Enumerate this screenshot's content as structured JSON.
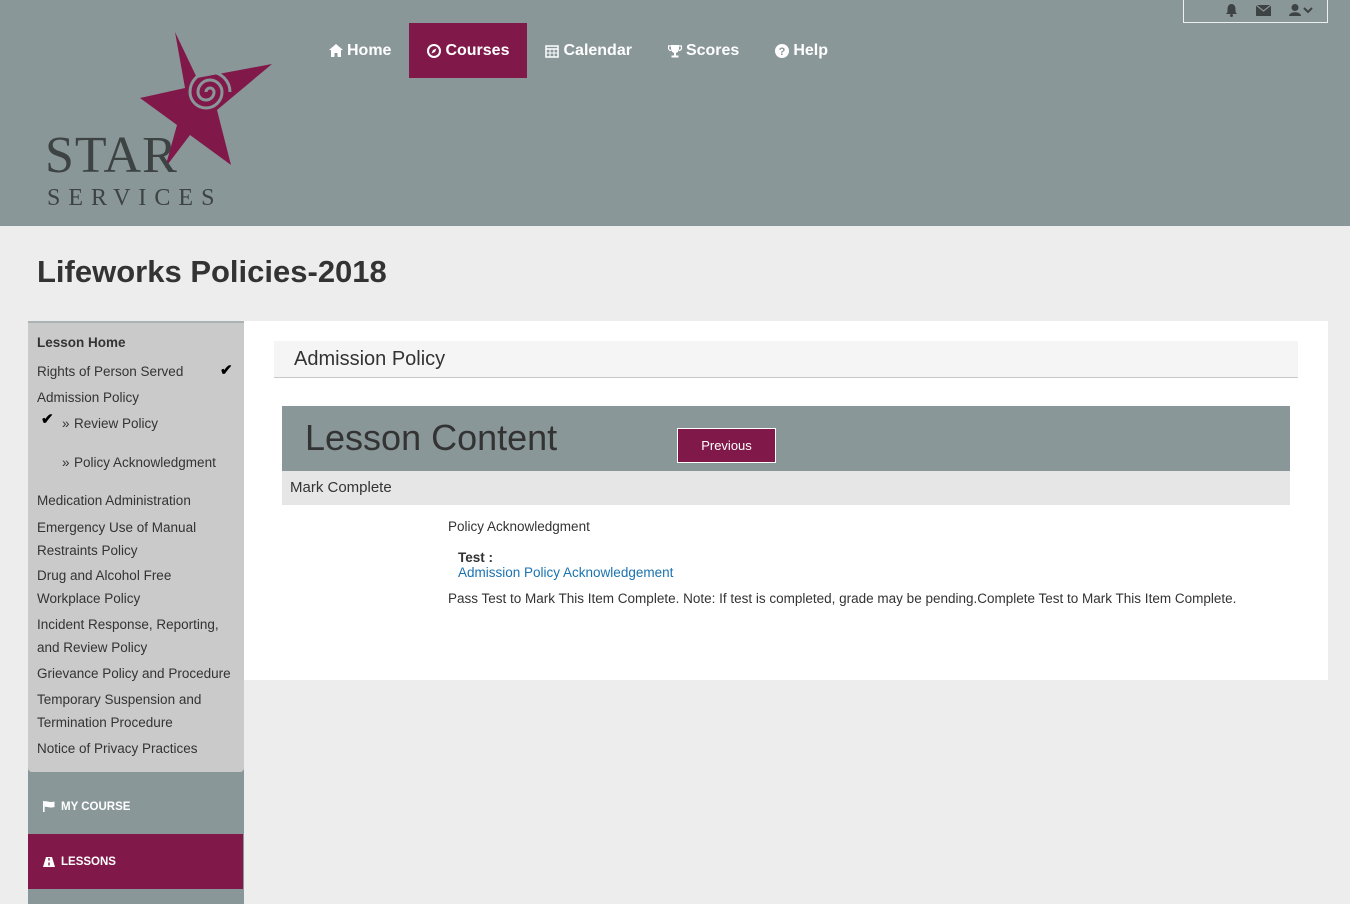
{
  "brand": {
    "line1": "STAR",
    "line2": "SERVICES",
    "logo_icon": "star-spiral-icon",
    "colors": {
      "accent": "#801949",
      "header": "#8a9799"
    }
  },
  "nav": [
    {
      "label": "Home",
      "icon": "home-icon"
    },
    {
      "label": "Courses",
      "icon": "compass-icon",
      "active": true
    },
    {
      "label": "Calendar",
      "icon": "calendar-icon"
    },
    {
      "label": "Scores",
      "icon": "trophy-icon"
    },
    {
      "label": "Help",
      "icon": "question-circle-icon"
    }
  ],
  "utility": [
    "bell-icon",
    "envelope-icon",
    "user-menu-icon"
  ],
  "page_title": "Lifeworks Policies-2018",
  "sidebar": {
    "lessons": [
      {
        "label": "Lesson Home"
      },
      {
        "label": "Rights of Person Served",
        "completed": true
      },
      {
        "label": "Admission Policy"
      },
      {
        "label": "Review Policy",
        "completed": true,
        "sub": true
      },
      {
        "label": "Policy Acknowledgment",
        "sub": true
      },
      {
        "label": "Medication Administration"
      },
      {
        "label": "Emergency Use of Manual Restraints Policy"
      },
      {
        "label": "Drug and Alcohol Free Workplace Policy"
      },
      {
        "label": "Incident Response, Reporting, and Review Policy"
      },
      {
        "label": "Grievance Policy and Procedure"
      },
      {
        "label": "Temporary Suspension and Termination Procedure"
      },
      {
        "label": "Notice of Privacy Practices"
      }
    ],
    "sub_marker": "»",
    "check_glyph": "✔",
    "buttons": [
      {
        "label": "MY COURSE",
        "icon": "flag-icon"
      },
      {
        "label": "LESSONS",
        "icon": "road-icon",
        "active": true
      }
    ]
  },
  "main": {
    "section_title": "Admission Policy",
    "lesson_content_title": "Lesson Content",
    "previous_label": "Previous",
    "mark_complete": "Mark Complete",
    "item_title": "Policy Acknowledgment",
    "test_label": "Test :",
    "test_link": "Admission Policy Acknowledgement",
    "note": "Pass Test to Mark This Item Complete. Note: If test is completed, grade may be pending.Complete Test to Mark This Item Complete."
  }
}
